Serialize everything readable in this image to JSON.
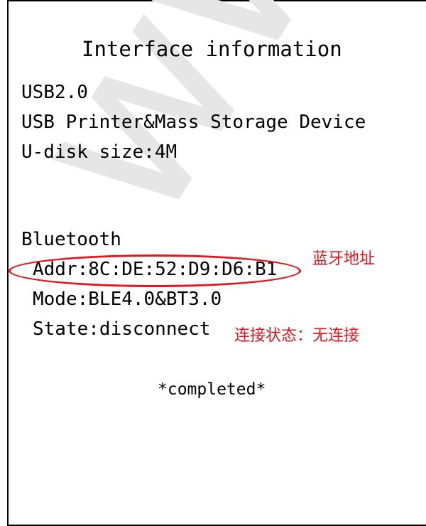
{
  "document": {
    "title": "Interface information",
    "usb_version": "USB2.0",
    "usb_device": "USB Printer&Mass Storage Device",
    "udisk_size": "U-disk size:4M",
    "bluetooth_heading": "Bluetooth",
    "bt_addr": "Addr:8C:DE:52:D9:D6:B1",
    "bt_mode": "Mode:BLE4.0&BT3.0",
    "bt_state": "State:disconnect",
    "footer": "*completed*"
  },
  "annotations": {
    "addr_note": "蓝牙地址",
    "state_note": "连接状态：无连接",
    "color": "#e8141d"
  },
  "watermark": {
    "text": "www.gall"
  }
}
